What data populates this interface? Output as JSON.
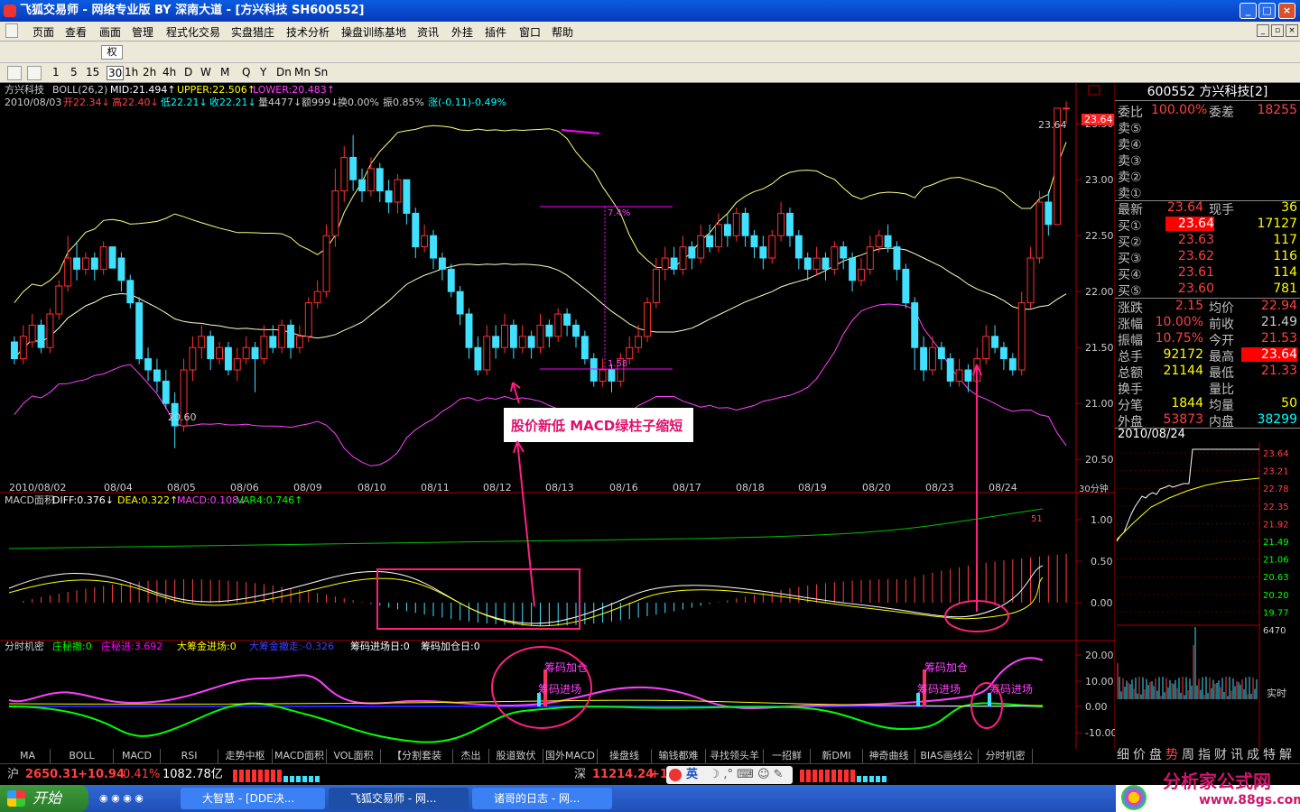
{
  "window": {
    "title": "飞狐交易师 - 网络专业版 BY 深南大道 - [方兴科技 SH600552]",
    "controls": [
      "_",
      "□",
      "×"
    ]
  },
  "menu": {
    "items": [
      "页面",
      "查看",
      "画面",
      "管理",
      "程式化交易",
      "实盘猎庄",
      "技术分析",
      "操盘训练基地",
      "资讯",
      "外挂",
      "插件",
      "窗口",
      "帮助"
    ]
  },
  "toolbar": {
    "right_dropdown": "权"
  },
  "periods": [
    "1",
    "5",
    "15",
    "30",
    "1h",
    "2h",
    "4h",
    "D",
    "W",
    "M",
    "Q",
    "Y",
    "Dn",
    "Mn",
    "Sn"
  ],
  "main_chart": {
    "header_line1": {
      "name": "方兴科技",
      "indicator": "BOLL(26,2)",
      "mid": "MID:21.494↑",
      "upper": "UPPER:22.506↑",
      "lower": "LOWER:20.483↑"
    },
    "header_line2": {
      "date": "2010/08/03",
      "open": "开22.34↓",
      "high": "高22.40↓",
      "low": "低22.21↓",
      "close": "收22.21↓",
      "volume": "量4477↓",
      "amount": "额999↓",
      "turnover": "换0.00%",
      "amplitude": "振0.85%",
      "change": "涨(-0.11)-0.49%"
    },
    "price_axis": [
      "23.50",
      "23.00",
      "22.50",
      "22.00",
      "21.50",
      "21.00",
      "20.50"
    ],
    "price_tag": "23.64",
    "high_label": "23.64",
    "low_label": "20.60",
    "measure_top": "7.4%",
    "measure_bottom": "1.58",
    "dates": [
      "2010/08/02",
      "08/04",
      "08/05",
      "08/06",
      "08/09",
      "08/10",
      "08/11",
      "08/12",
      "08/13",
      "08/16",
      "08/17",
      "08/18",
      "08/19",
      "08/20",
      "08/23",
      "08/24"
    ],
    "period_label": "30分钟",
    "annotation": "股价新低 MACD绿柱子缩短"
  },
  "macd_panel": {
    "name": "MACD面积",
    "diff": "DIFF:0.376↓",
    "dea": "DEA:0.322↑",
    "macd": "MACD:0.108↓",
    "var4": "VAR4:0.746↑",
    "axis": [
      "1.00",
      "0.50",
      "0.00"
    ],
    "tag": "51"
  },
  "fsjm_panel": {
    "name": "分时机密",
    "items": [
      {
        "label": "庄秘撤:0",
        "color": "#00ff00"
      },
      {
        "label": "庄秘进:3.692",
        "color": "#ff00ff"
      },
      {
        "label": "大筹金进场:0",
        "color": "#ffff00"
      },
      {
        "label": "大筹金撤走:-0.326",
        "color": "#4040ff"
      },
      {
        "label": "筹码进场日:0",
        "color": "#ffffff"
      },
      {
        "label": "筹码加仓日:0",
        "color": "#ffffff"
      }
    ],
    "axis": [
      "20.00",
      "10.00",
      "0.00",
      "-10.00"
    ],
    "labels": [
      "筹码加仓",
      "筹码进场",
      "筹码加仓",
      "筹码进场",
      "筹码进场"
    ]
  },
  "bottom_tabs": [
    "MA",
    "BOLL",
    "MACD",
    "RSI",
    "走势中枢",
    "MACD面积",
    "VOL面积",
    "【分割套装",
    "杰出",
    "股道致伏",
    "国外MACD",
    "操盘线",
    "输钱都难",
    "寻找领头羊",
    "一招鲜",
    "新DMI",
    "神奇曲线",
    "BIAS画线公",
    "分时机密"
  ],
  "right_tabs": [
    "细",
    "价",
    "盘",
    "势",
    "周",
    "指",
    "财",
    "讯",
    "成",
    "特",
    "解"
  ],
  "quote": {
    "title": "600552 方兴科技[2]",
    "weibi_label": "委比",
    "weibi": "100.00%",
    "weicha_label": "委差",
    "weicha": "18255",
    "sell_labels": [
      "卖⑤",
      "卖④",
      "卖③",
      "卖②",
      "卖①"
    ],
    "latest_label": "最新",
    "latest": "23.64",
    "xianshou_label": "现手",
    "xianshou": "36",
    "buys": [
      {
        "label": "买①",
        "price": "23.64",
        "vol": "17127"
      },
      {
        "label": "买②",
        "price": "23.63",
        "vol": "117"
      },
      {
        "label": "买③",
        "price": "23.62",
        "vol": "116"
      },
      {
        "label": "买④",
        "price": "23.61",
        "vol": "114"
      },
      {
        "label": "买⑤",
        "price": "23.60",
        "vol": "781"
      }
    ],
    "stats": [
      {
        "l1": "涨跌",
        "v1": "2.15",
        "l2": "均价",
        "v2": "22.94"
      },
      {
        "l1": "涨幅",
        "v1": "10.00%",
        "l2": "前收",
        "v2": "21.49"
      },
      {
        "l1": "振幅",
        "v1": "10.75%",
        "l2": "今开",
        "v2": "21.53"
      },
      {
        "l1": "总手",
        "v1": "92172",
        "l2": "最高",
        "v2": "23.64"
      },
      {
        "l1": "总额",
        "v1": "21144",
        "l2": "最低",
        "v2": "21.33"
      },
      {
        "l1": "换手",
        "v1": "",
        "l2": "量比",
        "v2": ""
      },
      {
        "l1": "分笔",
        "v1": "1844",
        "l2": "均量",
        "v2": "50"
      },
      {
        "l1": "外盘",
        "v1": "53873",
        "l2": "内盘",
        "v2": "38299"
      }
    ],
    "date": "2010/08/24",
    "mini_axis": [
      "23.64",
      "23.21",
      "22.78",
      "22.35",
      "21.92",
      "21.49",
      "21.06",
      "20.63",
      "20.20",
      "19.77"
    ],
    "vol_label": "6470",
    "realtime": "实时"
  },
  "status": {
    "sh_label": "沪",
    "sh_value": "2650.31",
    "sh_change": "+10.94",
    "sh_pct": "0.41%",
    "sh_amount": "1082.78亿",
    "sz_label": "深",
    "sz_value": "11214.24",
    "sz_change": "+1",
    "ime": "英"
  },
  "taskbar": {
    "start": "开始",
    "tasks": [
      "大智慧 - [DDE决...",
      "飞狐交易师 - 网...",
      "诸哥的日志 - 网..."
    ]
  },
  "watermark": {
    "text": "分析家公式网",
    "url": "www.88gs.com"
  },
  "chart_data": {
    "type": "candlestick",
    "ylim": [
      20.3,
      23.8
    ],
    "candles": [
      [
        21.55,
        21.4,
        21.6,
        21.35
      ],
      [
        21.4,
        21.6,
        21.7,
        21.35
      ],
      [
        21.55,
        21.7,
        21.8,
        21.5
      ],
      [
        21.7,
        21.5,
        21.75,
        21.45
      ],
      [
        21.5,
        21.8,
        21.85,
        21.45
      ],
      [
        21.8,
        22.05,
        22.1,
        21.75
      ],
      [
        22.05,
        22.3,
        22.5,
        22.0
      ],
      [
        22.3,
        22.2,
        22.45,
        22.1
      ],
      [
        22.2,
        22.3,
        22.35,
        22.15
      ],
      [
        22.3,
        22.2,
        22.35,
        22.1
      ],
      [
        22.2,
        22.4,
        22.45,
        22.15
      ],
      [
        22.4,
        22.21,
        22.4,
        22.21
      ],
      [
        22.3,
        22.1,
        22.35,
        22.0
      ],
      [
        22.1,
        21.9,
        22.15,
        21.85
      ],
      [
        21.9,
        21.4,
        21.95,
        21.35
      ],
      [
        21.4,
        21.3,
        21.5,
        21.2
      ],
      [
        21.3,
        21.2,
        21.4,
        21.1
      ],
      [
        21.2,
        21.0,
        21.3,
        20.95
      ],
      [
        21.0,
        20.8,
        21.1,
        20.6
      ],
      [
        20.8,
        21.3,
        21.4,
        20.75
      ],
      [
        21.3,
        21.5,
        21.6,
        21.2
      ],
      [
        21.5,
        21.6,
        21.7,
        21.4
      ],
      [
        21.6,
        21.4,
        21.65,
        21.3
      ],
      [
        21.4,
        21.5,
        21.55,
        21.35
      ],
      [
        21.5,
        21.3,
        21.55,
        21.25
      ],
      [
        21.3,
        21.4,
        21.5,
        21.2
      ],
      [
        21.4,
        21.5,
        21.6,
        21.35
      ],
      [
        21.5,
        21.4,
        21.55,
        21.1
      ],
      [
        21.4,
        21.6,
        21.7,
        21.35
      ],
      [
        21.6,
        21.5,
        21.7,
        21.45
      ],
      [
        21.5,
        21.7,
        21.75,
        21.45
      ],
      [
        21.7,
        21.5,
        21.75,
        21.4
      ],
      [
        21.5,
        21.6,
        21.7,
        21.45
      ],
      [
        21.6,
        21.9,
        21.95,
        21.55
      ],
      [
        21.9,
        22.0,
        22.1,
        21.85
      ],
      [
        22.0,
        22.5,
        22.6,
        21.95
      ],
      [
        22.5,
        22.9,
        23.1,
        22.4
      ],
      [
        22.9,
        23.2,
        23.3,
        22.8
      ],
      [
        23.2,
        23.0,
        23.4,
        22.9
      ],
      [
        23.0,
        22.9,
        23.1,
        22.8
      ],
      [
        22.9,
        23.1,
        23.2,
        22.85
      ],
      [
        23.1,
        22.9,
        23.15,
        22.8
      ],
      [
        22.9,
        22.8,
        23.0,
        22.7
      ],
      [
        22.8,
        23.0,
        23.05,
        22.7
      ],
      [
        23.0,
        22.7,
        23.0,
        22.6
      ],
      [
        22.7,
        22.4,
        22.75,
        22.3
      ],
      [
        22.4,
        22.5,
        22.6,
        22.35
      ],
      [
        22.5,
        22.3,
        22.55,
        22.2
      ],
      [
        22.3,
        22.2,
        22.35,
        22.1
      ],
      [
        22.2,
        22.0,
        22.25,
        21.95
      ],
      [
        22.0,
        21.8,
        22.05,
        21.7
      ],
      [
        21.8,
        21.5,
        21.85,
        21.4
      ],
      [
        21.5,
        21.3,
        21.6,
        21.25
      ],
      [
        21.3,
        21.6,
        21.7,
        21.25
      ],
      [
        21.6,
        21.5,
        21.7,
        21.4
      ],
      [
        21.5,
        21.7,
        21.8,
        21.45
      ],
      [
        21.7,
        21.5,
        21.75,
        21.4
      ],
      [
        21.5,
        21.6,
        21.7,
        21.45
      ],
      [
        21.6,
        21.5,
        21.65,
        21.4
      ],
      [
        21.5,
        21.7,
        21.8,
        21.45
      ],
      [
        21.7,
        21.6,
        21.75,
        21.5
      ],
      [
        21.6,
        21.8,
        21.85,
        21.55
      ],
      [
        21.8,
        21.7,
        21.85,
        21.6
      ],
      [
        21.7,
        21.6,
        21.75,
        21.5
      ],
      [
        21.6,
        21.4,
        21.65,
        21.35
      ],
      [
        21.4,
        21.2,
        21.45,
        21.15
      ],
      [
        21.2,
        21.3,
        21.4,
        21.15
      ],
      [
        21.3,
        21.2,
        21.35,
        21.1
      ],
      [
        21.2,
        21.4,
        21.45,
        21.15
      ],
      [
        21.4,
        21.5,
        21.6,
        21.35
      ],
      [
        21.5,
        21.6,
        21.7,
        21.45
      ],
      [
        21.6,
        21.9,
        21.95,
        21.55
      ],
      [
        21.9,
        22.2,
        22.3,
        21.85
      ],
      [
        22.2,
        22.3,
        22.4,
        22.1
      ],
      [
        22.3,
        22.2,
        22.4,
        22.15
      ],
      [
        22.2,
        22.4,
        22.5,
        22.15
      ],
      [
        22.4,
        22.3,
        22.45,
        22.2
      ],
      [
        22.3,
        22.5,
        22.6,
        22.25
      ],
      [
        22.5,
        22.4,
        22.6,
        22.35
      ],
      [
        22.4,
        22.6,
        22.7,
        22.35
      ],
      [
        22.6,
        22.5,
        22.7,
        22.4
      ],
      [
        22.5,
        22.7,
        22.75,
        22.45
      ],
      [
        22.7,
        22.5,
        22.75,
        22.4
      ],
      [
        22.5,
        22.4,
        22.55,
        22.3
      ],
      [
        22.4,
        22.3,
        22.5,
        22.2
      ],
      [
        22.3,
        22.5,
        22.55,
        22.25
      ],
      [
        22.5,
        22.7,
        22.8,
        22.45
      ],
      [
        22.7,
        22.5,
        22.75,
        22.4
      ],
      [
        22.5,
        22.3,
        22.55,
        22.2
      ],
      [
        22.3,
        22.2,
        22.35,
        22.1
      ],
      [
        22.2,
        22.3,
        22.4,
        22.15
      ],
      [
        22.3,
        22.2,
        22.35,
        22.1
      ],
      [
        22.2,
        22.4,
        22.45,
        22.15
      ],
      [
        22.4,
        22.3,
        22.45,
        22.2
      ],
      [
        22.3,
        22.1,
        22.35,
        22.0
      ],
      [
        22.1,
        22.2,
        22.3,
        22.05
      ],
      [
        22.2,
        22.4,
        22.5,
        22.15
      ],
      [
        22.4,
        22.5,
        22.55,
        22.35
      ],
      [
        22.5,
        22.4,
        22.6,
        22.35
      ],
      [
        22.4,
        22.2,
        22.45,
        22.1
      ],
      [
        22.2,
        21.9,
        22.25,
        21.85
      ],
      [
        21.9,
        21.5,
        21.95,
        21.3
      ],
      [
        21.5,
        21.3,
        21.6,
        21.2
      ],
      [
        21.3,
        21.5,
        21.6,
        21.25
      ],
      [
        21.5,
        21.4,
        21.55,
        21.3
      ],
      [
        21.4,
        21.2,
        21.45,
        21.15
      ],
      [
        21.2,
        21.3,
        21.4,
        21.15
      ],
      [
        21.3,
        21.2,
        21.35,
        21.1
      ],
      [
        21.2,
        21.4,
        21.5,
        21.15
      ],
      [
        21.4,
        21.6,
        21.7,
        21.35
      ],
      [
        21.6,
        21.5,
        21.7,
        21.45
      ],
      [
        21.5,
        21.4,
        21.55,
        21.3
      ],
      [
        21.4,
        21.3,
        21.45,
        21.25
      ],
      [
        21.3,
        21.9,
        22.0,
        21.25
      ],
      [
        21.9,
        22.3,
        22.4,
        21.85
      ],
      [
        22.3,
        22.8,
        22.9,
        22.25
      ],
      [
        22.8,
        22.6,
        22.9,
        22.5
      ],
      [
        22.6,
        23.64,
        23.64,
        22.6
      ],
      [
        23.64,
        23.64,
        23.7,
        23.5
      ]
    ]
  }
}
